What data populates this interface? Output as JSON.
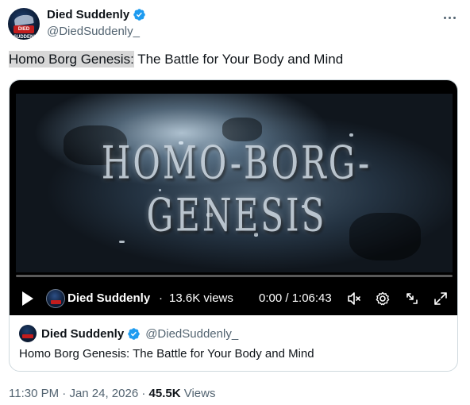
{
  "author": {
    "display_name": "Died Suddenly",
    "handle": "@DiedSuddenly_",
    "avatar_badge": "DIED SUDDENLY",
    "verified_color": "#1d9bf0"
  },
  "tweet": {
    "text_highlighted": "Homo Borg Genesis:",
    "text_rest": " The Battle for Your Body and Mind"
  },
  "video": {
    "title_overlay": "HOMO-BORG-GENESIS",
    "channel_name": "Died Suddenly",
    "dot": "·",
    "views": "13.6K views",
    "time": "0:00 / 1:06:43",
    "progress": 0
  },
  "quote": {
    "display_name": "Died Suddenly",
    "handle": "@DiedSuddenly_",
    "text": "Homo Borg Genesis: The Battle for Your Body and Mind"
  },
  "meta": {
    "time": "11:30 PM",
    "sep1": " · ",
    "date": "Jan 24, 2026",
    "sep2": " · ",
    "views_count": "45.5K",
    "views_label": " Views"
  },
  "icons": [
    "more-icon",
    "verified-icon",
    "play-icon",
    "mute-icon",
    "settings-icon",
    "pip-icon",
    "fullscreen-icon"
  ]
}
